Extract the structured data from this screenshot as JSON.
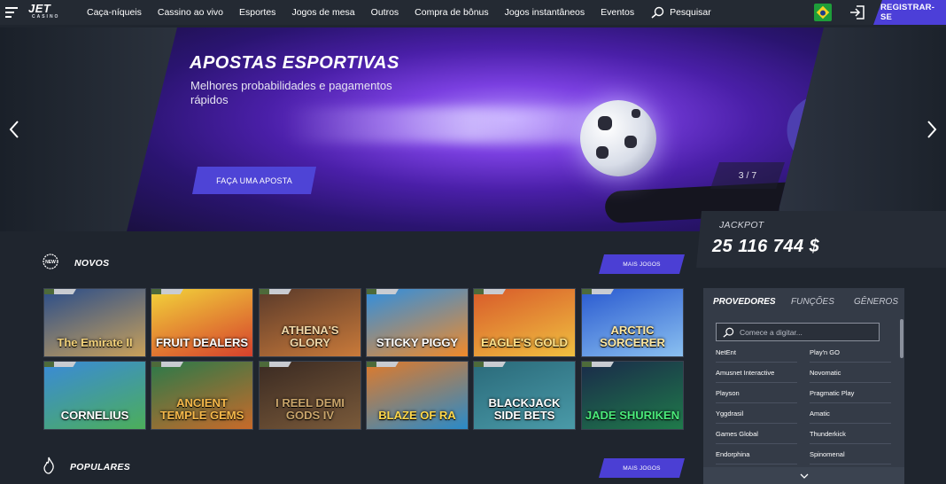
{
  "header": {
    "logo": "JET",
    "logo_sub": "CASINO",
    "nav": [
      "Caça-níqueis",
      "Cassino ao vivo",
      "Esportes",
      "Jogos de mesa",
      "Outros",
      "Compra de bônus",
      "Jogos instantâneos",
      "Eventos"
    ],
    "search_label": "Pesquisar",
    "register_label": "REGISTRAR-SE"
  },
  "hero": {
    "title": "APOSTAS ESPORTIVAS",
    "subtitle": "Melhores probabilidades e pagamentos rápidos",
    "cta": "FAÇA UMA APOSTA",
    "counter": "3 / 7"
  },
  "jackpot": {
    "label": "JACKPOT",
    "value": "25 116 744 $"
  },
  "sections": {
    "new": {
      "title": "NOVOS",
      "more": "MAIS JOGOS"
    },
    "popular": {
      "title": "POPULARES",
      "more": "MAIS JOGOS"
    }
  },
  "games": [
    {
      "name": "The Emirate II",
      "color1": "#2a4d8a",
      "color2": "#c9a15a",
      "text": "#f3d27a"
    },
    {
      "name": "FRUIT DEALERS",
      "color1": "#f2d43a",
      "color2": "#d6402c",
      "text": "#ffffff"
    },
    {
      "name": "ATHENA'S GLORY",
      "color1": "#5a3a2a",
      "color2": "#c97a3a",
      "text": "#f0d7a8"
    },
    {
      "name": "STICKY PIGGY",
      "color1": "#2f8fe0",
      "color2": "#f08a2a",
      "text": "#ffffff"
    },
    {
      "name": "EAGLE'S GOLD",
      "color1": "#d85a2a",
      "color2": "#f0c040",
      "text": "#ffe28a"
    },
    {
      "name": "ARCTIC SORCERER",
      "color1": "#2a5ad0",
      "color2": "#8ac0f0",
      "text": "#ffe8a0"
    },
    {
      "name": "CORNELIUS",
      "color1": "#3a8ad8",
      "color2": "#4cae5a",
      "text": "#ffffff"
    },
    {
      "name": "ANCIENT TEMPLE GEMS",
      "color1": "#2a7a4a",
      "color2": "#c86a2a",
      "text": "#f5b84a"
    },
    {
      "name": "I REEL DEMI GODS IV",
      "color1": "#3a2a22",
      "color2": "#7a5a3a",
      "text": "#c8a46a"
    },
    {
      "name": "BLAZE OF RA",
      "color1": "#e07a2a",
      "color2": "#2a8ac8",
      "text": "#ffd84a"
    },
    {
      "name": "BLACKJACK SIDE BETS",
      "color1": "#2a6a7a",
      "color2": "#4a9aa8",
      "text": "#ffffff"
    },
    {
      "name": "JADE SHURIKEN",
      "color1": "#1a2a4a",
      "color2": "#1f7a4a",
      "text": "#4aea7a"
    }
  ],
  "providers": {
    "tabs": [
      "PROVEDORES",
      "FUNÇÕES",
      "GÊNEROS"
    ],
    "search_placeholder": "Comece a digitar...",
    "left": [
      "NetEnt",
      "Amusnet Interactive",
      "Playson",
      "Yggdrasil",
      "Games Global",
      "Endorphina"
    ],
    "right": [
      "Play'n GO",
      "Novomatic",
      "Pragmatic Play",
      "Amatic",
      "Thunderkick",
      "Spinomenal"
    ]
  },
  "colors": {
    "accent": "#4c3fd8",
    "background": "#1f252e"
  }
}
